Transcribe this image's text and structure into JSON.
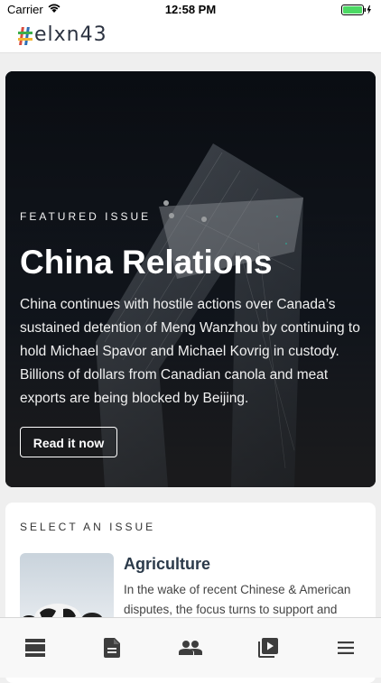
{
  "status_bar": {
    "carrier": "Carrier",
    "time": "12:58 PM"
  },
  "header": {
    "logo_text": "elxn43"
  },
  "featured": {
    "kicker": "FEATURED ISSUE",
    "title": "China Relations",
    "description": "China continues with hostile actions over Canada’s sustained detention of Meng Wanzhou by continuing to hold Michael Spavor and Michael Kovrig in custody. Billions of dollars from Canadian canola and meat exports are being blocked by Beijing.",
    "button_label": "Read it now"
  },
  "select": {
    "title": "SELECT AN ISSUE",
    "issues": [
      {
        "name": "Agriculture",
        "description": "In the wake of recent Chinese & American disputes, the focus turns to support and"
      }
    ]
  },
  "tabs": [
    {
      "icon": "feed-icon"
    },
    {
      "icon": "document-icon"
    },
    {
      "icon": "people-icon"
    },
    {
      "icon": "video-library-icon"
    },
    {
      "icon": "menu-icon"
    }
  ],
  "colors": {
    "battery": "#4cd964",
    "logo_hash": [
      "#d94c3d",
      "#2b6fb5",
      "#3cae4a",
      "#f2b632"
    ]
  }
}
